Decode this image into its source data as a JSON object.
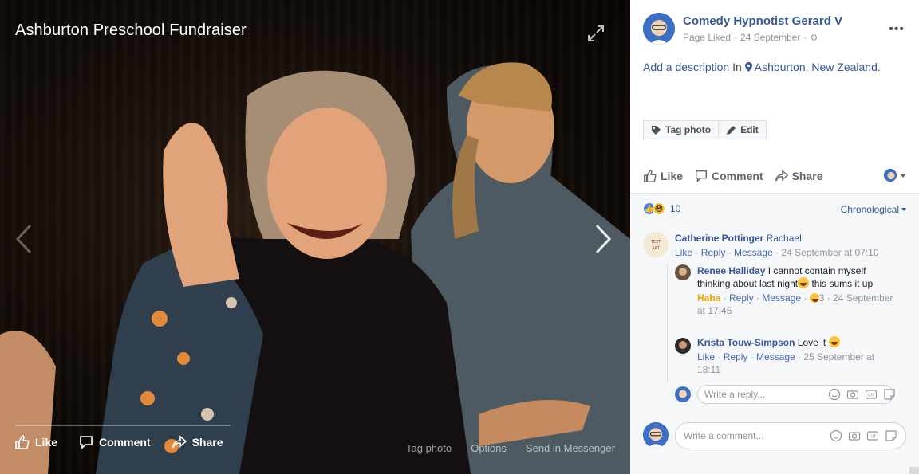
{
  "album": {
    "title": "Ashburton Preschool Fundraiser"
  },
  "photo_actions": {
    "like": "Like",
    "comment": "Comment",
    "share": "Share"
  },
  "photo_meta": {
    "tag_photo": "Tag photo",
    "options": "Options",
    "send": "Send in Messenger"
  },
  "post": {
    "author": "Comedy Hypnotist Gerard V",
    "status": "Page Liked",
    "date": "24 September",
    "description_link": "Add a description",
    "in_word": "In",
    "location": "Ashburton, New Zealand",
    "location_suffix": "."
  },
  "tag_buttons": {
    "tag_photo": "Tag photo",
    "edit": "Edit"
  },
  "ufi": {
    "like": "Like",
    "comment": "Comment",
    "share": "Share"
  },
  "reactions": {
    "count": "10"
  },
  "order": {
    "label": "Chronological"
  },
  "comments": [
    {
      "name": "Catherine Pottinger",
      "tag": "Rachael",
      "links": {
        "like": "Like",
        "reply": "Reply",
        "message": "Message",
        "time": "24 September at 07:10"
      }
    }
  ],
  "replies": [
    {
      "name": "Renee Halliday",
      "text": "I cannot contain myself thinking about last night",
      "text2": "this sums it up",
      "links": {
        "reaction": "Haha",
        "reply": "Reply",
        "message": "Message",
        "count": "3",
        "time": "24 September at 17:45"
      }
    },
    {
      "name": "Krista Touw-Simpson",
      "text": "Love it",
      "links": {
        "like": "Like",
        "reply": "Reply",
        "message": "Message",
        "time": "25 September at 18:11"
      }
    }
  ],
  "reply_box": {
    "placeholder": "Write a reply..."
  },
  "comment_box": {
    "placeholder": "Write a comment..."
  },
  "colors": {
    "link": "#365899",
    "muted": "#90949c",
    "text": "#1d2129",
    "like_blue": "#4080ff",
    "haha_yellow": "#f7c33a"
  }
}
